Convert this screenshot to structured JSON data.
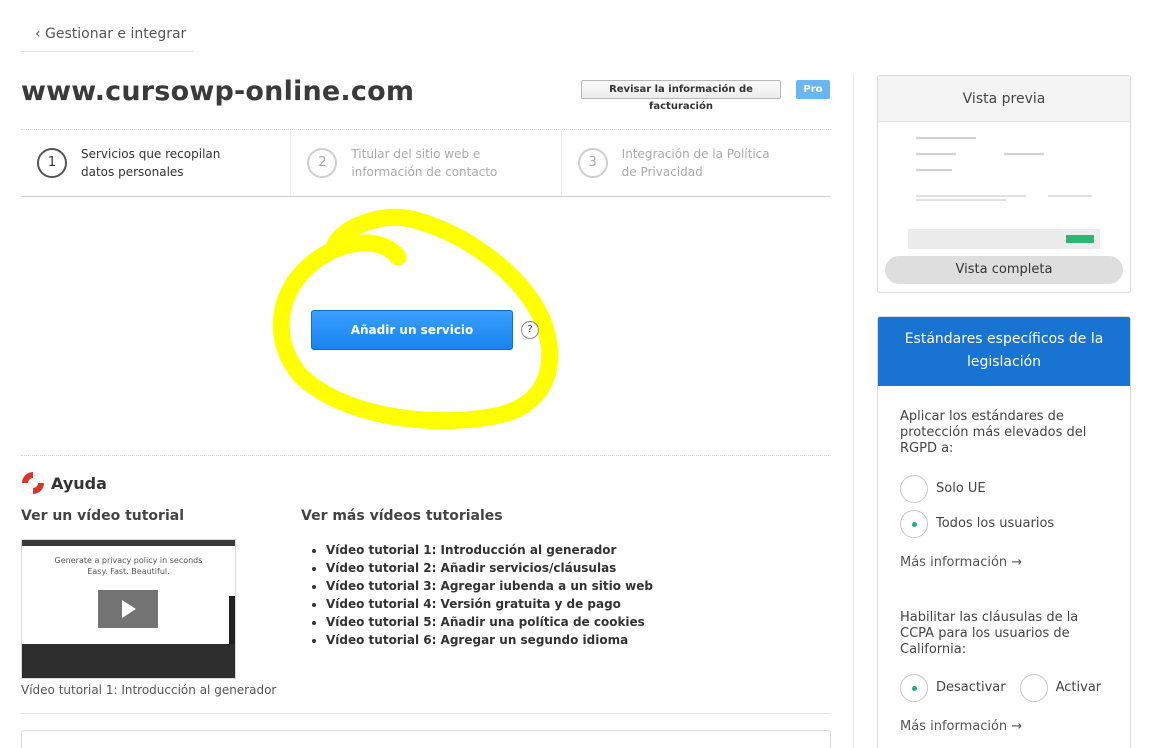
{
  "nav": {
    "back_label": "‹ Gestionar e integrar"
  },
  "header": {
    "site_title": "www.cursowp-online.com",
    "billing_button": "Revisar la información de facturación",
    "plan_badge": "Pro"
  },
  "steps": [
    {
      "number": "1",
      "label": "Servicios que recopilan datos personales"
    },
    {
      "number": "2",
      "label": "Titular del sitio web e información de contacto"
    },
    {
      "number": "3",
      "label": "Integración de la Política de Privacidad"
    }
  ],
  "main": {
    "add_service_button": "Añadir un servicio",
    "help_icon_glyph": "?"
  },
  "help": {
    "title": "Ayuda",
    "video_heading": "Ver un vídeo tutorial",
    "more_heading": "Ver más vídeos tutoriales",
    "video_thumb_line1": "Generate a privacy policy in seconds",
    "video_thumb_line2": "Easy. Fast. Beautiful.",
    "video_caption": "Vídeo tutorial 1: Introducción al generador",
    "tutorials": [
      "Vídeo tutorial 1: Introducción al generador",
      "Vídeo tutorial 2: Añadir servicios/cláusulas",
      "Vídeo tutorial 3: Agregar iubenda a un sitio web",
      "Vídeo tutorial 4: Versión gratuita y de pago",
      "Vídeo tutorial 5: Añadir una política de cookies",
      "Vídeo tutorial 6: Agregar un segundo idioma"
    ]
  },
  "preview": {
    "title": "Vista previa",
    "full_view_button": "Vista completa"
  },
  "legislation": {
    "title": "Estándares específicos de la legislación",
    "gdpr_question": "Aplicar los estándares de protección más elevados del RGPD a:",
    "gdpr_options": [
      {
        "label": "Solo UE",
        "selected": false
      },
      {
        "label": "Todos los usuarios",
        "selected": true
      }
    ],
    "more_info_1": "Más información  →",
    "ccpa_question": "Habilitar las cláusulas de la CCPA para los usuarios de California:",
    "ccpa_options": [
      {
        "label": "Desactivar",
        "selected": true
      },
      {
        "label": "Activar",
        "selected": false
      }
    ],
    "more_info_2": "Más información  →"
  },
  "colors": {
    "primary_button": "#1783f0",
    "legislation_header": "#1873d3",
    "highlight_marker": "#ffff00",
    "radio_selected": "#1bb08a",
    "pro_badge": "#6ab6f0"
  }
}
